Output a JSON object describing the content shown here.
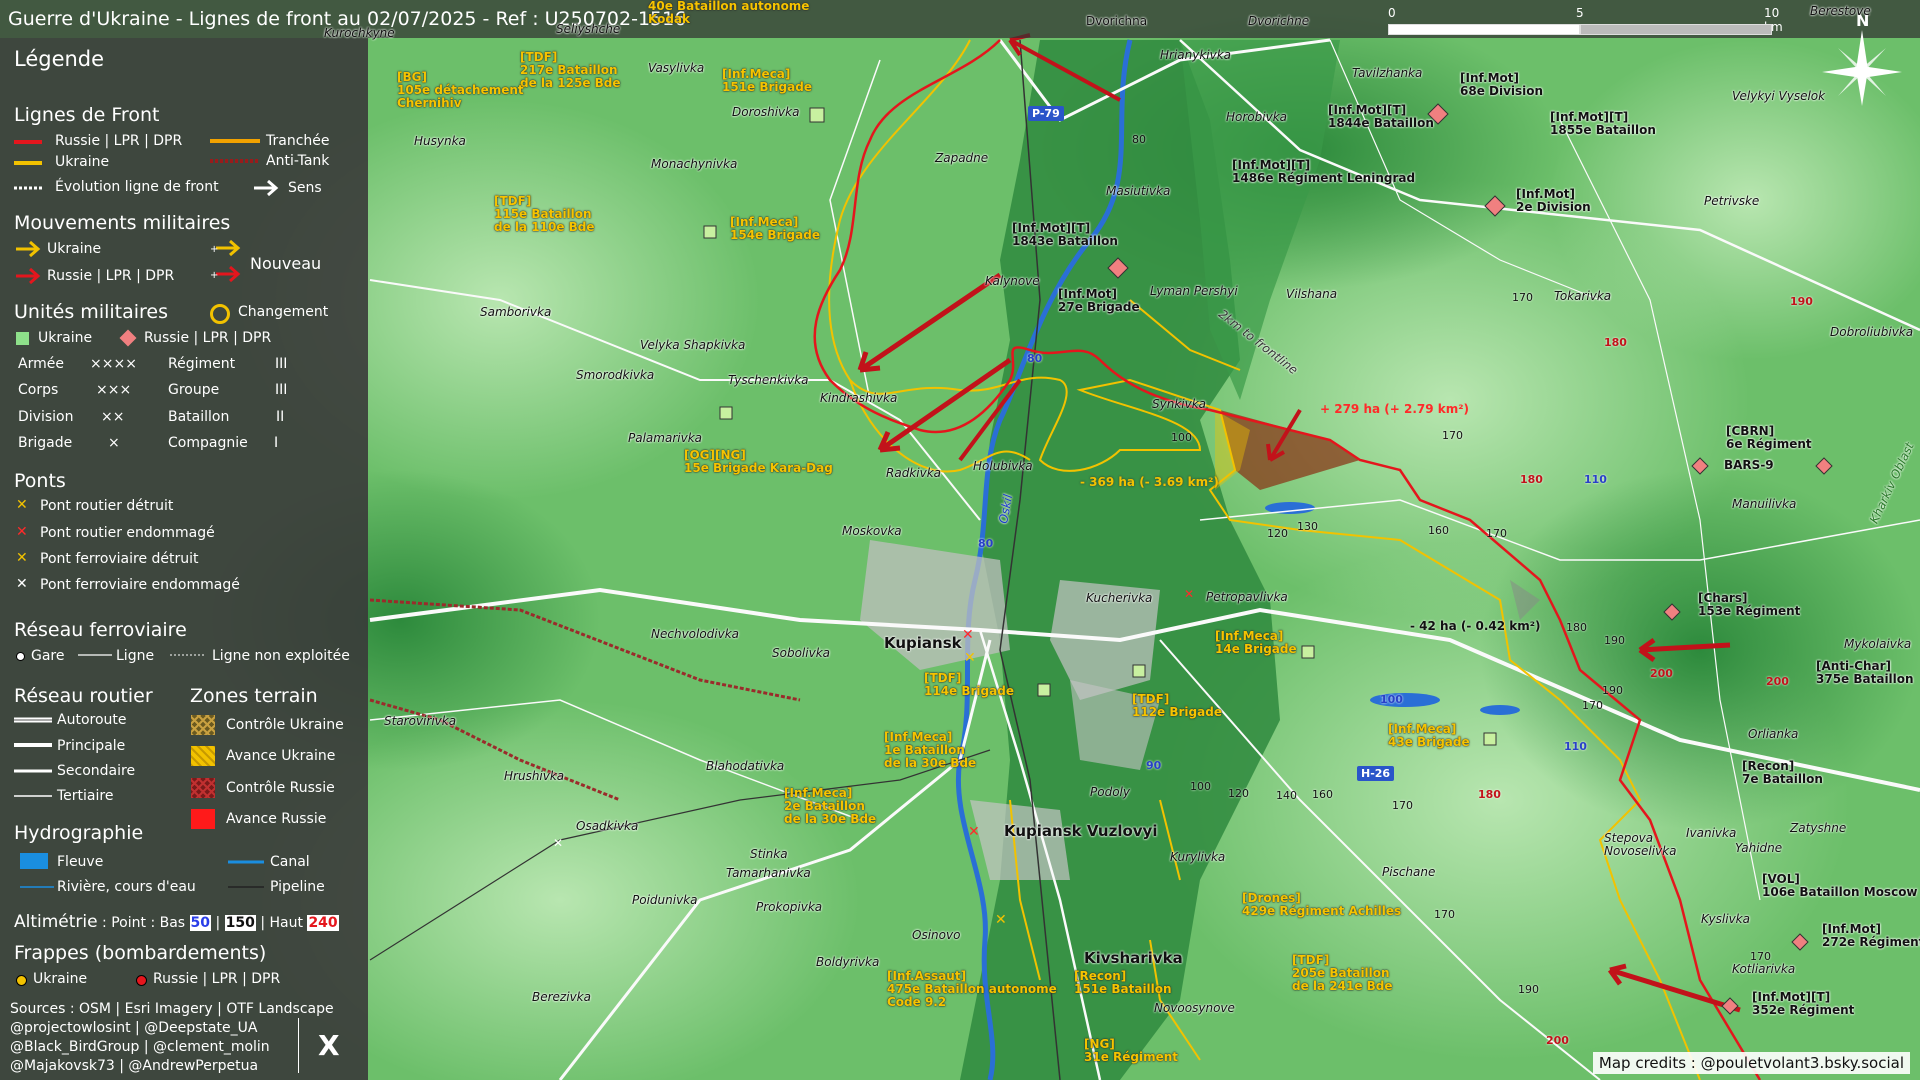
{
  "title": "Guerre d'Ukraine - Lignes de front au 02/07/2025 - Ref : U250702-1516",
  "scale": {
    "labels": [
      "0",
      "5",
      "10 km"
    ]
  },
  "compass": {
    "label": "N"
  },
  "legend": {
    "title": "Légende",
    "front": {
      "heading": "Lignes de Front",
      "russia": "Russie | LPR | DPR",
      "ukraine": "Ukraine",
      "evolution": "Évolution ligne de front",
      "trench": "Tranchée",
      "antitank": "Anti-Tank",
      "direction": "Sens"
    },
    "movements": {
      "heading": "Mouvements militaires",
      "ukraine": "Ukraine",
      "russia": "Russie | LPR | DPR",
      "new": "Nouveau"
    },
    "units": {
      "heading": "Unités militaires",
      "change": "Changement",
      "ukraine": "Ukraine",
      "russia": "Russie | LPR | DPR",
      "echelons": [
        {
          "name": "Armée",
          "symbol": "××××"
        },
        {
          "name": "Corps",
          "symbol": "×××"
        },
        {
          "name": "Division",
          "symbol": "××"
        },
        {
          "name": "Brigade",
          "symbol": "×"
        },
        {
          "name": "Régiment",
          "symbol": "III"
        },
        {
          "name": "Groupe",
          "symbol": "III"
        },
        {
          "name": "Bataillon",
          "symbol": "II"
        },
        {
          "name": "Compagnie",
          "symbol": "I"
        }
      ]
    },
    "bridges": {
      "heading": "Ponts",
      "items": [
        {
          "label": "Pont routier détruit",
          "color": "#f2c200"
        },
        {
          "label": "Pont routier endommagé",
          "color": "#ff2a2a"
        },
        {
          "label": "Pont ferroviaire détruit",
          "color": "#f2c200"
        },
        {
          "label": "Pont ferroviaire endommagé",
          "color": "#ffffff"
        }
      ]
    },
    "rail": {
      "heading": "Réseau ferroviaire",
      "station": "Gare",
      "line": "Ligne",
      "unused": "Ligne non exploitée"
    },
    "roads": {
      "heading": "Réseau routier",
      "items": [
        "Autoroute",
        "Principale",
        "Secondaire",
        "Tertiaire"
      ]
    },
    "terrain": {
      "heading": "Zones terrain",
      "items": [
        {
          "label": "Contrôle Ukraine",
          "color": "#c8a040"
        },
        {
          "label": "Avance Ukraine",
          "color": "#f2c200"
        },
        {
          "label": "Contrôle Russie",
          "color": "#b03030"
        },
        {
          "label": "Avance Russie",
          "color": "#ff1a1a"
        }
      ]
    },
    "hydro": {
      "heading": "Hydrographie",
      "river": "Fleuve",
      "canal": "Canal",
      "stream": "Rivière, cours d'eau",
      "pipeline": "Pipeline"
    },
    "altimetry": {
      "heading": "Altimétrie",
      "text": " : Point : Bas ",
      "low": "50",
      "mid": "150",
      "high": "240",
      "sep": " | ",
      "high_label": " | Haut "
    },
    "strikes": {
      "heading": "Frappes (bombardements)",
      "ukraine": "Ukraine",
      "russia": "Russie | LPR | DPR"
    },
    "sources": [
      "Sources : OSM | Esri Imagery | OTF Landscape",
      "@projectowlosint | @Deepstate_UA",
      "@Black_BirdGroup | @clement_molin",
      "@Majakovsk73 | @AndrewPerpetua"
    ],
    "x_logo": "X"
  },
  "credits": "Map credits : @pouletvolant3.bsky.social",
  "changes": [
    {
      "label": "+ 279 ha (+ 2.79 km²)",
      "color": "#ff2a2a"
    },
    {
      "label": "- 369 ha (- 3.69 km²)",
      "color": "#f2c200"
    },
    {
      "label": "- 42 ha (- 0.42 km²)",
      "color": "#f2c200"
    }
  ],
  "road_tags": [
    "P-79",
    "H-26"
  ],
  "places": [
    "Kurochkyne",
    "Seliyshche",
    "Dvorichna",
    "Dvorichne",
    "Hrianykivka",
    "Tavilzhanka",
    "Vasylivka",
    "Doroshivka",
    "Husynka",
    "Monachynivka",
    "Zapadne",
    "Horobivka",
    "Masiutivka",
    "Samborivka",
    "Kalynove",
    "Lyman Pershyi",
    "Vilshana",
    "Tokarivka",
    "Velyka Shapkivka",
    "Smorodkivka",
    "Tyschenkivka",
    "Kindrashivka",
    "Synkivka",
    "Palamarivka",
    "Radkivka",
    "Holubivka",
    "Moskovka",
    "Oskil",
    "Kupiansk",
    "Kucherivka",
    "Petropavlivka",
    "Nechvolodivka",
    "Sobolivka",
    "Starovirivka",
    "Blahodativka",
    "Podoly",
    "Hrushivka",
    "Kupiansk Vuzlovyi",
    "Osadkivka",
    "Stinka",
    "Tamarhanivka",
    "Kurylivka",
    "Pischane",
    "Poidunivka",
    "Prokopivka",
    "Osinovo",
    "Kivsharivka",
    "Boldyrivka",
    "Berezivka",
    "Novoosynove",
    "Velykyi Vyselok",
    "Petrivske",
    "Dobroliubivka",
    "Manuilivka",
    "Mykolaivka",
    "Orlianka",
    "Zatyshne",
    "Stepova Novoselivka",
    "Ivanivka",
    "Yahidne",
    "Kyslivka",
    "Kotliarivka",
    "Berestove",
    "2km to frontline",
    "Kharkiv Oblast"
  ],
  "units": [
    {
      "label": "[TDF]\n217e Bataillon\nde la 125e Bde",
      "side": "ua"
    },
    {
      "label": "[BG]\n105e détachement\nChernihiv",
      "side": "ua"
    },
    {
      "label": "[Inf.Meca]\n151e Brigade",
      "side": "ua"
    },
    {
      "label": "40e Bataillon autonome\nKodak",
      "side": "ua"
    },
    {
      "label": "[TDF]\n115e Bataillon\nde la 110e Bde",
      "side": "ua"
    },
    {
      "label": "[Inf.Meca]\n154e Brigade",
      "side": "ua"
    },
    {
      "label": "[OG][NG]\n15e Brigade Kara-Dag",
      "side": "ua"
    },
    {
      "label": "[TDF]\n114e Brigade",
      "side": "ua"
    },
    {
      "label": "[TDF]\n112e Brigade",
      "side": "ua"
    },
    {
      "label": "[Inf.Meca]\n14e Brigade",
      "side": "ua"
    },
    {
      "label": "[Inf.Meca]\n43e Brigade",
      "side": "ua"
    },
    {
      "label": "[Inf.Meca]\n1e Bataillon\nde la 30e Bde",
      "side": "ua"
    },
    {
      "label": "[Inf.Meca]\n2e Bataillon\nde la 30e Bde",
      "side": "ua"
    },
    {
      "label": "[Drones]\n429e Régiment Achilles",
      "side": "ua"
    },
    {
      "label": "[Inf.Assaut]\n475e Bataillon autonome\nCode 9.2",
      "side": "ua"
    },
    {
      "label": "[Recon]\n151e Bataillon",
      "side": "ua"
    },
    {
      "label": "[TDF]\n205e Bataillon\nde la 241e Bde",
      "side": "ua"
    },
    {
      "label": "[NG]\n31e Régiment",
      "side": "ua"
    },
    {
      "label": "[Inf.Mot]\n68e Division",
      "side": "ru"
    },
    {
      "label": "[Inf.Mot][T]\n1844e Bataillon",
      "side": "ru"
    },
    {
      "label": "[Inf.Mot][T]\n1855e Bataillon",
      "side": "ru"
    },
    {
      "label": "[Inf.Mot][T]\n1486e Régiment Leningrad",
      "side": "ru"
    },
    {
      "label": "[Inf.Mot]\n2e Division",
      "side": "ru"
    },
    {
      "label": "[Inf.Mot][T]\n1843e Bataillon",
      "side": "ru"
    },
    {
      "label": "[Inf.Mot]\n27e Brigade",
      "side": "ru"
    },
    {
      "label": "[CBRN]\n6e Régiment",
      "side": "ru"
    },
    {
      "label": "BARS-9",
      "side": "ru"
    },
    {
      "label": "[Chars]\n153e Régiment",
      "side": "ru"
    },
    {
      "label": "[Anti-Char]\n375e Bataillon",
      "side": "ru"
    },
    {
      "label": "[Recon]\n7e Bataillon",
      "side": "ru"
    },
    {
      "label": "[VOL]\n106e Bataillon Moscow",
      "side": "ru"
    },
    {
      "label": "[Inf.Mot]\n272e Régiment",
      "side": "ru"
    },
    {
      "label": "[Inf.Mot][T]\n352e Régiment",
      "side": "ru"
    }
  ],
  "elevations": [
    {
      "v": "80",
      "c": ""
    },
    {
      "v": "170",
      "c": ""
    },
    {
      "v": "190",
      "c": "red"
    },
    {
      "v": "180",
      "c": "red"
    },
    {
      "v": "80",
      "c": "blue"
    },
    {
      "v": "100",
      "c": ""
    },
    {
      "v": "170",
      "c": ""
    },
    {
      "v": "110",
      "c": "blue"
    },
    {
      "v": "180",
      "c": "red"
    },
    {
      "v": "120",
      "c": ""
    },
    {
      "v": "130",
      "c": ""
    },
    {
      "v": "160",
      "c": ""
    },
    {
      "v": "170",
      "c": ""
    },
    {
      "v": "80",
      "c": "blue"
    },
    {
      "v": "180",
      "c": ""
    },
    {
      "v": "190",
      "c": ""
    },
    {
      "v": "200",
      "c": "red"
    },
    {
      "v": "200",
      "c": "red"
    },
    {
      "v": "100",
      "c": "blue"
    },
    {
      "v": "170",
      "c": ""
    },
    {
      "v": "190",
      "c": ""
    },
    {
      "v": "110",
      "c": "blue"
    },
    {
      "v": "90",
      "c": "blue"
    },
    {
      "v": "100",
      "c": ""
    },
    {
      "v": "120",
      "c": ""
    },
    {
      "v": "140",
      "c": ""
    },
    {
      "v": "160",
      "c": ""
    },
    {
      "v": "170",
      "c": ""
    },
    {
      "v": "180",
      "c": "red"
    },
    {
      "v": "170",
      "c": ""
    },
    {
      "v": "190",
      "c": ""
    },
    {
      "v": "200",
      "c": "red"
    },
    {
      "v": "170",
      "c": ""
    }
  ]
}
